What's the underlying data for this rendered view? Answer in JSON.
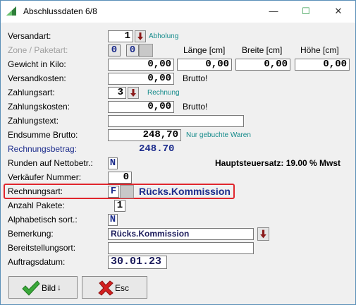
{
  "window": {
    "title": "Abschlussdaten 6/8",
    "minimize": "—",
    "maximize": "☐",
    "close": "✕"
  },
  "labels": {
    "versandart": "Versandart:",
    "zone": "Zone / Paketart:",
    "gewicht": "Gewicht  in Kilo:",
    "versandkosten": "Versandkosten:",
    "zahlungsart": "Zahlungsart:",
    "zahlungskosten": "Zahlungskosten:",
    "zahlungstext": "Zahlungstext:",
    "endsumme": "Endsumme Brutto:",
    "rechnungsbetrag": "Rechnungsbetrag:",
    "runden": "Runden auf Nettobetr.:",
    "verkaeufer": "Verkäufer Nummer:",
    "rechnungsart": "Rechnungsart:",
    "anzahl": "Anzahl Pakete:",
    "alphabetisch": "Alphabetisch sort.:",
    "bemerkung": "Bemerkung:",
    "bereitstellungsort": "Bereitstellungsort:",
    "auftragsdatum": "Auftragsdatum:"
  },
  "columns": {
    "laenge": "Länge [cm]",
    "breite": "Breite [cm]",
    "hoehe": "Höhe [cm]"
  },
  "values": {
    "versandart": "1",
    "versandart_text": "Abholung",
    "zone": "0",
    "paketart": "0",
    "gewicht": "0,00",
    "laenge": "0,00",
    "breite": "0,00",
    "hoehe": "0,00",
    "versandkosten": "0,00",
    "versandkosten_note": "Brutto!",
    "zahlungsart": "3",
    "zahlungsart_text": "Rechnung",
    "zahlungskosten": "0,00",
    "zahlungskosten_note": "Brutto!",
    "zahlungstext": "",
    "endsumme": "248,70",
    "endsumme_note": "Nur gebuchte Waren",
    "rechnungsbetrag": "248.70",
    "hauptsteuersatz": "Hauptsteuersatz: 19.00 % Mwst",
    "runden": "N",
    "verkaeufer": "0",
    "rechnungsart": "F",
    "rechnungsart_text": "Rücks.Kommission",
    "anzahl": "1",
    "alphabetisch": "N",
    "bemerkung": "Rücks.Kommission",
    "bereitstellungsort": "",
    "auftragsdatum": "30.01.23"
  },
  "buttons": {
    "bild": "Bild",
    "bild_arrow": "↓",
    "esc": "Esc"
  },
  "colors": {
    "accent_blue": "#1c2c8c",
    "note_teal": "#138a8a",
    "highlight_red": "#e0262d"
  }
}
